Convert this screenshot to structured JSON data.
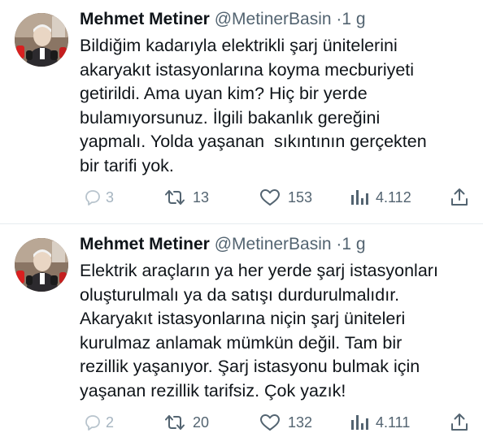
{
  "tweets": [
    {
      "author": {
        "name": "Mehmet Metiner",
        "handle": "@MetinerBasin",
        "separator": "·",
        "time": "1 g",
        "avatar": "avatar-photo"
      },
      "text_lines": [
        "Bildiğim kadarıyla elektrikli şarj ünitelerini",
        "akaryakıt istasyonlarına koyma mecburiyeti",
        "getirildi. Ama uyan kim? Hiç bir yerde",
        "bulamıyorsunuz. İlgili bakanlık gereğini",
        "yapmalı. Yolda yaşanan  sıkıntının gerçekten",
        "bir tarifi yok."
      ],
      "actions": {
        "reply": {
          "icon": "reply-icon",
          "count": "3"
        },
        "retweet": {
          "icon": "retweet-icon",
          "count": "13"
        },
        "like": {
          "icon": "heart-icon",
          "count": "153"
        },
        "views": {
          "icon": "views-icon",
          "count": "4.112"
        },
        "share": {
          "icon": "share-icon"
        }
      }
    },
    {
      "author": {
        "name": "Mehmet Metiner",
        "handle": "@MetinerBasin",
        "separator": "·",
        "time": "1 g",
        "avatar": "avatar-photo"
      },
      "text_lines": [
        "Elektrik araçların ya her yerde şarj istasyonları",
        "oluşturulmalı ya da satışı durdurulmalıdır.",
        "Akaryakıt istasyonlarına niçin şarj üniteleri",
        "kurulmaz anlamak mümkün değil. Tam bir",
        "rezillik yaşanıyor. Şarj istasyonu bulmak için",
        "yaşanan rezillik tarifsiz. Çok yazık!"
      ],
      "actions": {
        "reply": {
          "icon": "reply-icon",
          "count": "2"
        },
        "retweet": {
          "icon": "retweet-icon",
          "count": "20"
        },
        "like": {
          "icon": "heart-icon",
          "count": "132"
        },
        "views": {
          "icon": "views-icon",
          "count": "4.111"
        },
        "share": {
          "icon": "share-icon"
        }
      }
    }
  ],
  "colors": {
    "text": "#0f1419",
    "secondary": "#536471",
    "divider": "#e6ecf0"
  }
}
